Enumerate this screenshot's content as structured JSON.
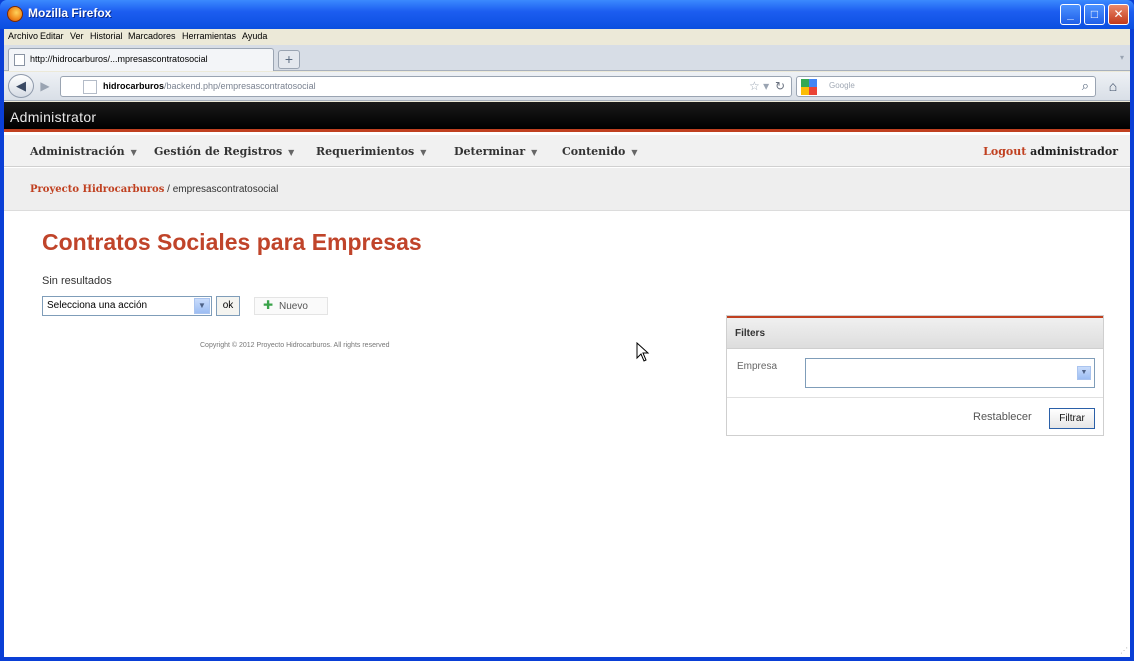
{
  "window": {
    "title": "Mozilla Firefox"
  },
  "menubar": {
    "items": [
      "Archivo",
      "Editar",
      "Ver",
      "Historial",
      "Marcadores",
      "Herramientas",
      "Ayuda"
    ]
  },
  "tab": {
    "label": "http://hidrocarburos/...mpresascontratosocial",
    "new_tab_symbol": "+"
  },
  "navbar": {
    "url_host": "hidrocarburos",
    "url_path": "/backend.php/empresascontratosocial",
    "search_placeholder": "Google"
  },
  "site": {
    "brand": "Administrator",
    "menu": [
      {
        "label": "Administración"
      },
      {
        "label": "Gestión de Registros"
      },
      {
        "label": "Requerimientos"
      },
      {
        "label": "Determinar"
      },
      {
        "label": "Contenido"
      }
    ],
    "logout_label": "Logout",
    "username": "administrador",
    "breadcrumb": {
      "home": "Proyecto Hidrocarburos",
      "separator": " / ",
      "current": "empresascontratosocial"
    },
    "page_title": "Contratos Sociales para Empresas",
    "no_results": "Sin resultados",
    "batch_action": {
      "selected": "Selecciona una acción",
      "ok_label": "ok"
    },
    "new_label": "Nuevo",
    "copyright": "Copyright © 2012 Proyecto Hidrocarburos. All rights reserved",
    "filters": {
      "title": "Filters",
      "field_label": "Empresa",
      "field_value": "",
      "reset_label": "Restablecer",
      "submit_label": "Filtrar"
    },
    "colors": {
      "accent": "#c0442a",
      "header_bg": "#000000"
    }
  }
}
